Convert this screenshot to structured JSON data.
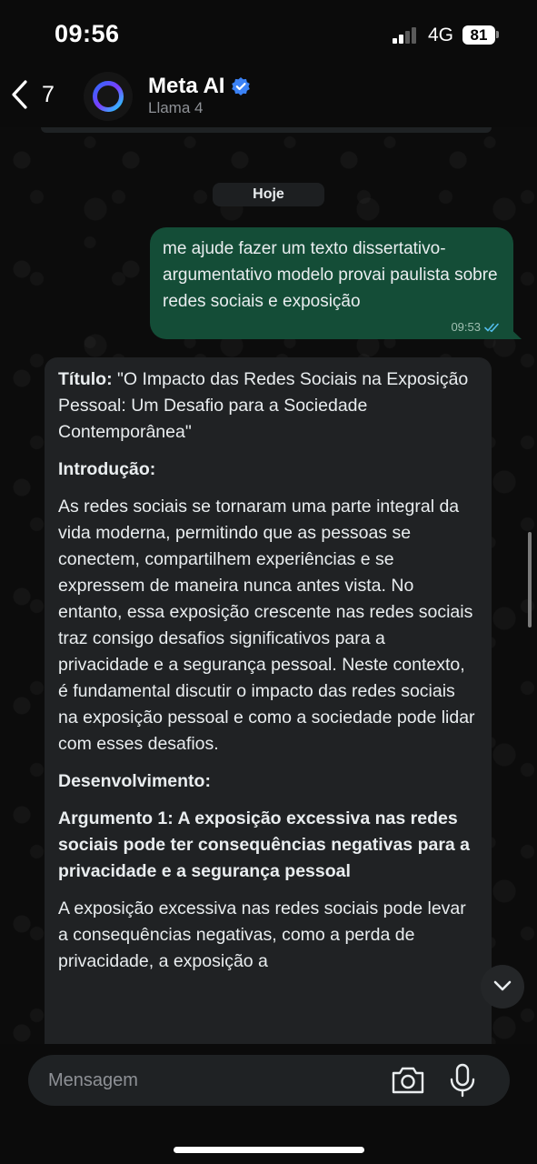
{
  "status_bar": {
    "time": "09:56",
    "network": "4G",
    "battery": "81"
  },
  "header": {
    "back_count": "7",
    "contact_name": "Meta AI",
    "contact_subtitle": "Llama 4",
    "icons": {
      "back": "chevron-left-icon",
      "avatar": "meta-ai-ring-icon",
      "verified": "verified-badge-icon"
    }
  },
  "chat": {
    "date_chip": "Hoje",
    "outgoing": {
      "text": "me ajude fazer um texto dissertativo-argumentativo modelo provai paulista sobre redes sociais e exposição",
      "time": "09:53",
      "status_icon": "double-check-icon"
    },
    "incoming": {
      "title_label": "Título:",
      "title_text": " \"O Impacto das Redes Sociais na Exposição Pessoal: Um Desafio para a Sociedade Contemporânea\"",
      "intro_heading": "Introdução:",
      "intro_paragraph": "As redes sociais se tornaram uma parte integral da vida moderna, permitindo que as pessoas se conectem, compartilhem experiências e se expressem de maneira nunca antes vista. No entanto, essa exposição crescente nas redes sociais traz consigo desafios significativos para a privacidade e a segurança pessoal. Neste contexto, é fundamental discutir o impacto das redes sociais na exposição pessoal e como a sociedade pode lidar com esses desafios.",
      "development_heading": "Desenvolvimento:",
      "argument1_heading": "Argumento 1: A exposição excessiva nas redes sociais pode ter consequências negativas para a privacidade e a segurança pessoal",
      "argument1_paragraph": "A exposição excessiva nas redes sociais pode levar a consequências negativas, como a perda de privacidade, a exposição a"
    }
  },
  "input": {
    "placeholder": "Mensagem",
    "icons": {
      "camera": "camera-icon",
      "mic": "microphone-icon",
      "scroll_down": "chevron-down-icon"
    }
  },
  "colors": {
    "outgoing_bubble": "#144d37",
    "incoming_bubble": "#202224",
    "background": "#0b0b0b",
    "accent_ring": "#3d8bff"
  }
}
